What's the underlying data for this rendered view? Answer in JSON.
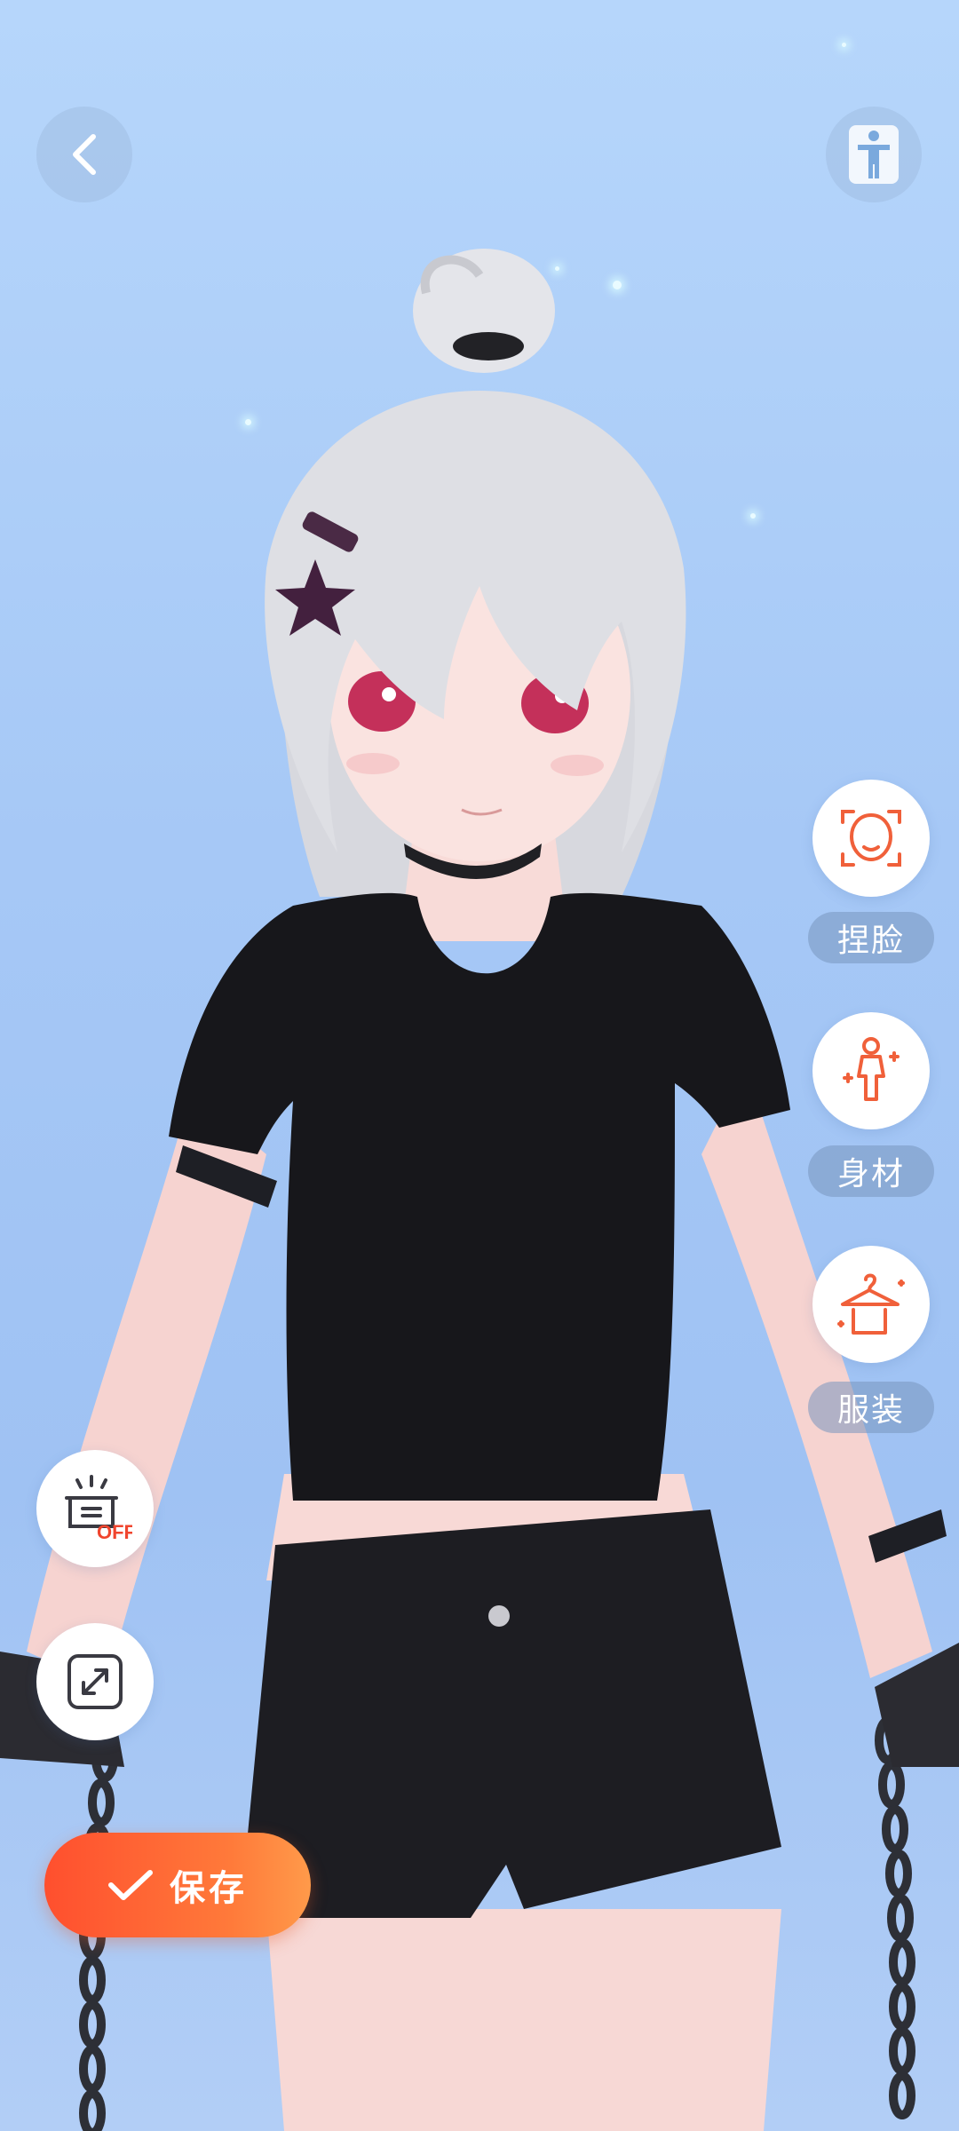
{
  "toolbar": {
    "back_icon": "chevron-left-icon",
    "pose_icon": "standing-figure-icon"
  },
  "side_menu": {
    "items": [
      {
        "label": "捏脸",
        "icon": "face-icon"
      },
      {
        "label": "身材",
        "icon": "body-icon"
      },
      {
        "label": "服装",
        "icon": "clothes-hanger-icon"
      }
    ]
  },
  "left_tools": {
    "toggle_icon": "lamp-off-icon",
    "toggle_badge": "OFF",
    "fullscreen_icon": "expand-icon"
  },
  "save_button": {
    "label": "保存",
    "icon": "checkmark-icon"
  },
  "colors": {
    "accent": "#ff5a2e",
    "accent_end": "#ff9a4a",
    "icon_orange": "#f0603a",
    "background_top": "#b6d6fb",
    "background_bottom": "#9fc2f3"
  }
}
